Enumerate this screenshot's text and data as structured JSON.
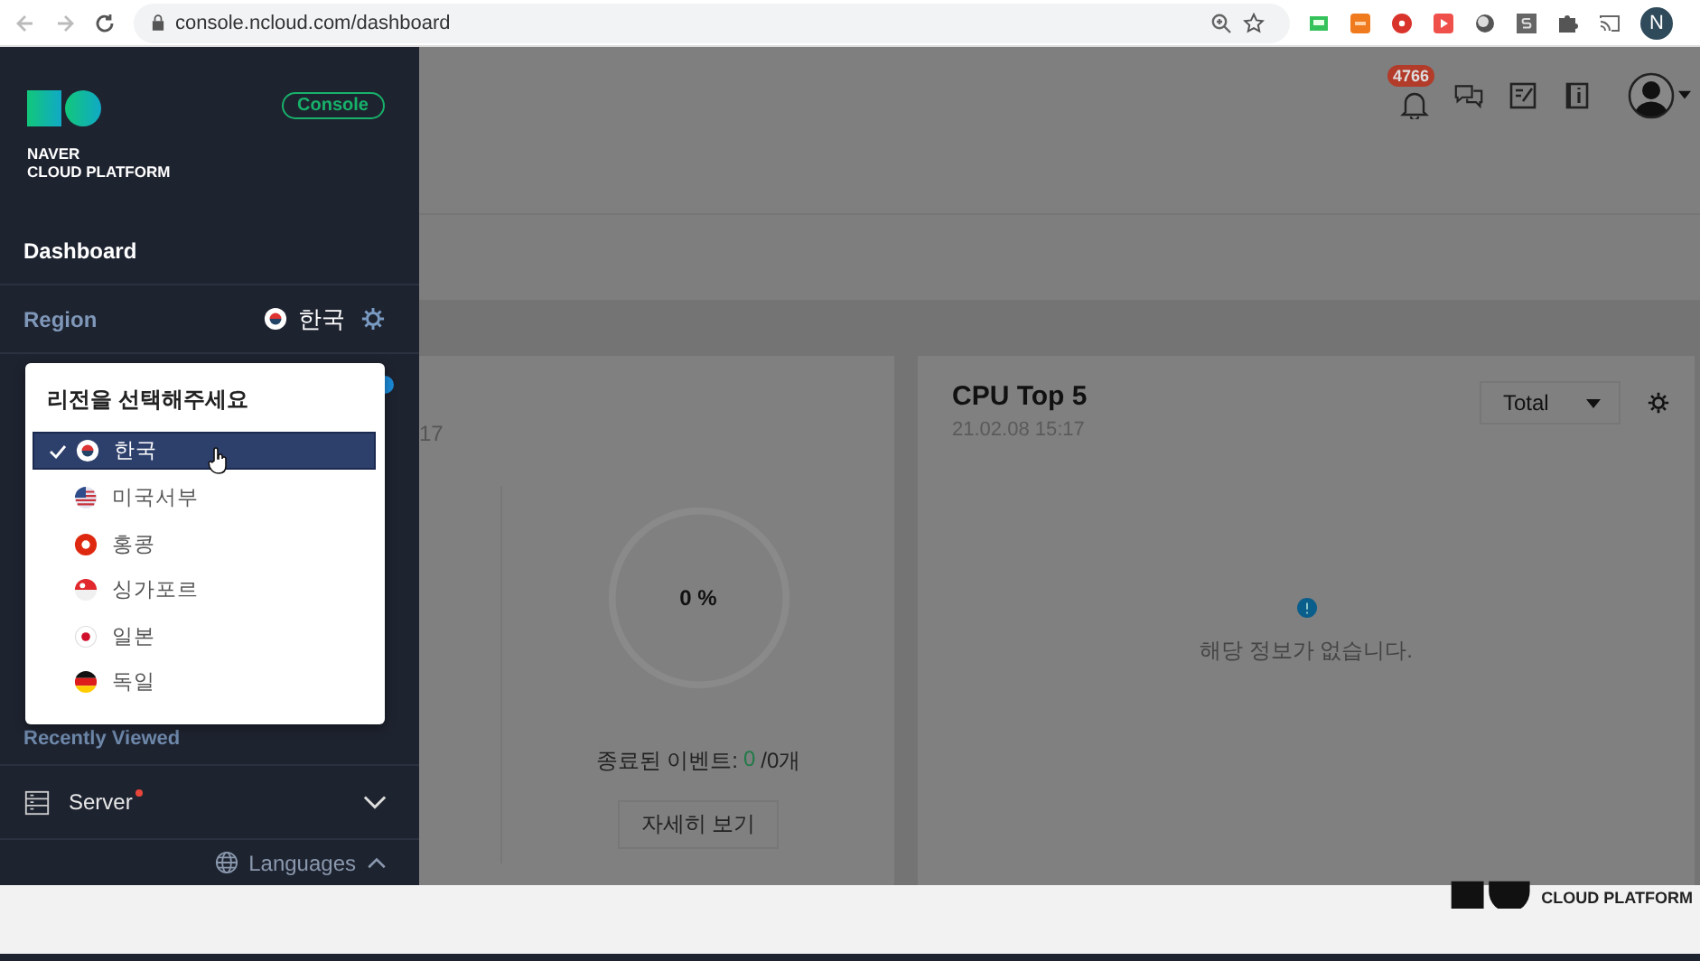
{
  "browser": {
    "url": "console.ncloud.com/dashboard",
    "profile_initial": "N"
  },
  "sidebar": {
    "brand_line1": "NAVER",
    "brand_line2": "CLOUD PLATFORM",
    "console_badge": "Console",
    "nav": [
      {
        "label": "Dashboard"
      }
    ],
    "region": {
      "label": "Region",
      "value": "한국"
    },
    "recently_viewed": "Recently Viewed",
    "recent_items": [
      {
        "label": "Server",
        "new": true,
        "expanded": false
      }
    ],
    "languages": {
      "label": "Languages",
      "expanded": true
    }
  },
  "region_dropdown": {
    "title": "리전을 선택해주세요",
    "options": [
      {
        "label": "한국",
        "selected": true
      },
      {
        "label": "미국서부",
        "selected": false
      },
      {
        "label": "홍콩",
        "selected": false
      },
      {
        "label": "싱가포르",
        "selected": false
      },
      {
        "label": "일본",
        "selected": false
      },
      {
        "label": "독일",
        "selected": false
      }
    ]
  },
  "header": {
    "notification_count": "4766"
  },
  "cards": [
    {
      "date_fragment": "17",
      "gauge": {
        "reading": "0 %",
        "level": 0
      },
      "events_label": "종료된 이벤트:",
      "events_done": "0",
      "events_total": "/0개",
      "details_button": "자세히 보기"
    },
    {
      "title": "CPU Top 5",
      "date": "21.02.08 15:17",
      "filter": "Total",
      "empty_message": "해당 정보가 없습니다."
    }
  ],
  "footer": {
    "brand": "CLOUD PLATFORM"
  }
}
